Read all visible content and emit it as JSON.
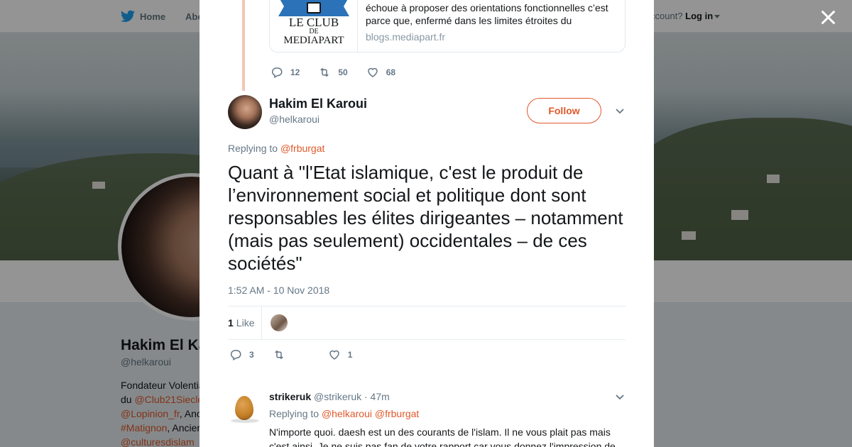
{
  "nav": {
    "home_label": "Home",
    "about_label": "Abo",
    "account_prompt": "ccount?",
    "login_label": "Log in"
  },
  "profile": {
    "name": "Hakim El Ka",
    "handle": "@helkaroui",
    "bio_lines": [
      {
        "text": "Fondateur Volentia",
        "link": ""
      },
      {
        "text": "du ",
        "link": "@Club21Siecle"
      },
      {
        "text": ", Anc",
        "link": "@Lopinion_fr"
      },
      {
        "text": ", Ancier",
        "link": "#Matignon"
      },
      {
        "text": "",
        "link": "@culturesdislam"
      }
    ]
  },
  "quoted_card": {
    "logo_line1": "LE CLUB",
    "logo_line2": "DE",
    "logo_line3": "MEDIAPART",
    "description": " échoue à proposer des orientations fonctionnelles c’est parce que, enfermé dans les limites étroites du",
    "domain": "blogs.mediapart.fr"
  },
  "parent_actions": {
    "replies": "12",
    "retweets": "50",
    "likes": "68"
  },
  "tweet": {
    "author_name": "Hakim El Karoui",
    "author_handle": "@helkaroui",
    "follow_label": "Follow",
    "replying_prefix": "Replying to ",
    "replying_to": "@frburgat",
    "text": "Quant à \"l'Etat islamique, c'est le produit de l’environnement social et politique dont sont responsables les élites dirigeantes – notamment (mais pas seulement) occidentales – de ces sociétés\"",
    "timestamp": "1:52 AM - 10 Nov 2018",
    "like_count": "1",
    "like_label": "Like",
    "actions": {
      "replies": "3",
      "retweets": "",
      "likes": "1"
    }
  },
  "reply": {
    "name": "strikeruk",
    "handle": "@strikeruk · 47m",
    "replying_prefix": "Replying to ",
    "replying_to_1": "@helkaroui",
    "replying_to_2": "@frburgat",
    "text": "N'importe quoi. daesh est un des courants de l'islam. Il ne vous plait pas mais c'est ainsi. Je ne suis pas fan de votre rapport car vous donnez l'impression de"
  },
  "colors": {
    "accent": "#e0592a",
    "twitter_blue": "#1da1f2",
    "muted": "#657786"
  }
}
